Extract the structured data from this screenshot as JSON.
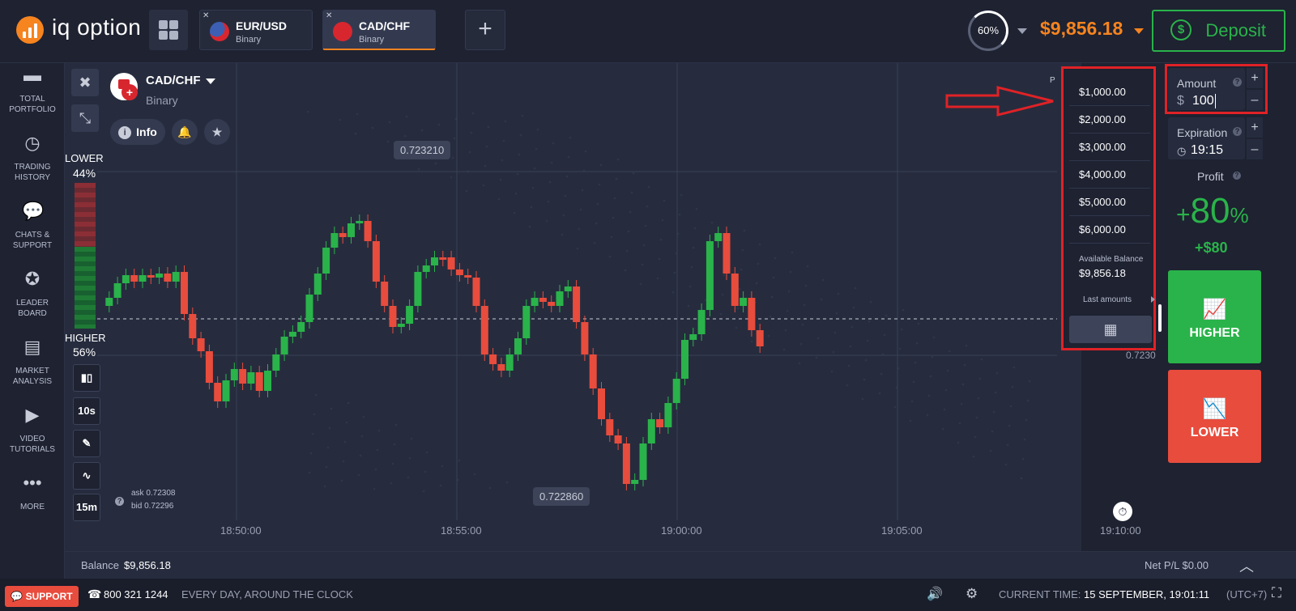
{
  "app": {
    "logo_text": "iq option"
  },
  "tabs": [
    {
      "label": "EUR/USD",
      "type": "Binary",
      "active": false
    },
    {
      "label": "CAD/CHF",
      "type": "Binary",
      "active": true
    }
  ],
  "header": {
    "ring_percent": "60%",
    "balance": "$9,856.18",
    "deposit_label": "Deposit"
  },
  "sidebar": [
    {
      "icon": "briefcase-icon",
      "line1": "TOTAL",
      "line2": "PORTFOLIO"
    },
    {
      "icon": "history-icon",
      "line1": "TRADING",
      "line2": "HISTORY"
    },
    {
      "icon": "chat-icon",
      "line1": "CHATS &",
      "line2": "SUPPORT"
    },
    {
      "icon": "medal-icon",
      "line1": "LEADER",
      "line2": "BOARD"
    },
    {
      "icon": "newspaper-icon",
      "line1": "MARKET",
      "line2": "ANALYSIS"
    },
    {
      "icon": "play-icon",
      "line1": "VIDEO",
      "line2": "TUTORIALS"
    },
    {
      "icon": "more-icon",
      "line1": "MORE",
      "line2": ""
    }
  ],
  "asset": {
    "name": "CAD/CHF",
    "type": "Binary",
    "info_label": "Info"
  },
  "sentiment": {
    "lower_label": "LOWER",
    "lower_pct": "44%",
    "higher_label": "HIGHER",
    "higher_pct": "56%",
    "higher_fraction": 0.56
  },
  "tools": {
    "timeframe": "10s",
    "period": "15m"
  },
  "quotes": {
    "ask": "ask 0.72308",
    "bid": "bid 0.72296"
  },
  "chart_data": {
    "type": "candlestick",
    "high_label": "0.723210",
    "low_label": "0.722860",
    "current_price_label": "0.7230",
    "partial_label": "P",
    "x_ticks": [
      "18:50:00",
      "18:55:00",
      "19:00:00",
      "19:05:00",
      "19:10:00"
    ]
  },
  "amount_dropdown": {
    "options": [
      "$1,000.00",
      "$2,000.00",
      "$3,000.00",
      "$4,000.00",
      "$5,000.00",
      "$6,000.00"
    ],
    "available_label": "Available Balance",
    "available_value": "$9,856.18",
    "last_amounts_label": "Last amounts"
  },
  "trade": {
    "amount_label": "Amount",
    "currency": "$",
    "amount_value": "100",
    "expiration_label": "Expiration",
    "expiration_value": "19:15",
    "profit_label": "Profit",
    "profit_pct": "80",
    "profit_pct_sign": "+",
    "profit_pct_unit": "%",
    "profit_value": "+$80",
    "higher_label": "HIGHER",
    "lower_label": "LOWER"
  },
  "balance_bar": {
    "balance_label": "Balance",
    "balance_value": "$9,856.18",
    "netpl": "Net P/L $0.00"
  },
  "footer": {
    "support_label": "SUPPORT",
    "phone": "800 321 1244",
    "hours": "EVERY DAY, AROUND THE CLOCK",
    "time_label": "CURRENT TIME:",
    "time_value": "15 SEPTEMBER, 19:01:11",
    "tz": "(UTC+7)"
  },
  "colors": {
    "accent": "#f6841f",
    "up": "#2ab34a",
    "down": "#e84c3d",
    "annotation": "#e02226"
  }
}
